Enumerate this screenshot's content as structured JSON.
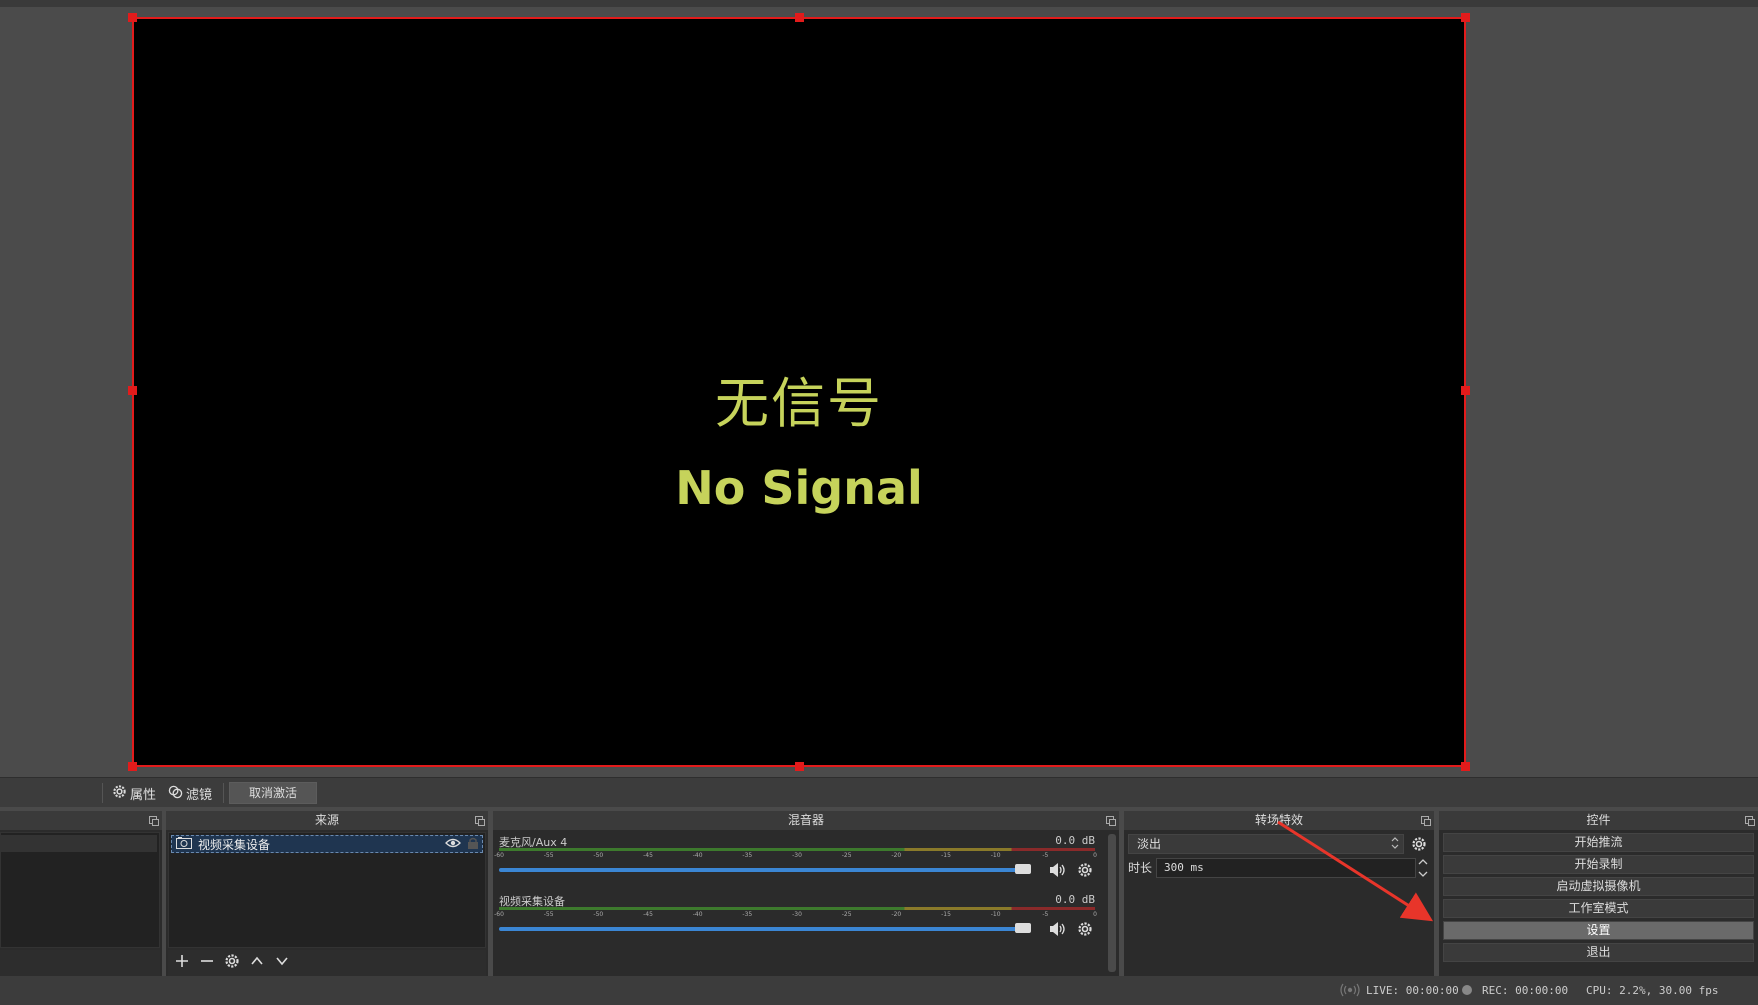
{
  "preview": {
    "no_signal_zh": "无信号",
    "no_signal_en": "No Signal",
    "border_color": "#e21b1b",
    "text_color": "#c6d35b"
  },
  "source_toolbar": {
    "properties_label": "属性",
    "filters_label": "滤镜",
    "deactivate_label": "取消激活"
  },
  "docks": {
    "scenes_title": "",
    "sources_title": "来源",
    "mixer_title": "混音器",
    "transitions_title": "转场特效",
    "controls_title": "控件"
  },
  "sources": {
    "items": [
      {
        "label": "视频采集设备",
        "icon": "camera-icon",
        "visible": true,
        "locked": false
      }
    ]
  },
  "mixer": {
    "channels": [
      {
        "name": "麦克风/Aux 4",
        "db": "0.0 dB",
        "volume": 1.0
      },
      {
        "name": "视频采集设备",
        "db": "0.0 dB",
        "volume": 1.0
      }
    ],
    "ticks": [
      "-60",
      "-55",
      "-50",
      "-45",
      "-40",
      "-35",
      "-30",
      "-25",
      "-20",
      "-15",
      "-10",
      "-5",
      "0"
    ]
  },
  "transitions": {
    "selected": "淡出",
    "duration_label": "时长",
    "duration_value": "300 ms"
  },
  "controls": {
    "buttons": [
      {
        "label": "开始推流",
        "highlighted": false
      },
      {
        "label": "开始录制",
        "highlighted": false
      },
      {
        "label": "启动虚拟摄像机",
        "highlighted": false
      },
      {
        "label": "工作室模式",
        "highlighted": false
      },
      {
        "label": "设置",
        "highlighted": true
      },
      {
        "label": "退出",
        "highlighted": false
      }
    ]
  },
  "status": {
    "live": "LIVE: 00:00:00",
    "rec": "REC: 00:00:00",
    "cpu": "CPU: 2.2%, 30.00 fps"
  },
  "annotation": {
    "arrow_color": "#e8352a"
  }
}
